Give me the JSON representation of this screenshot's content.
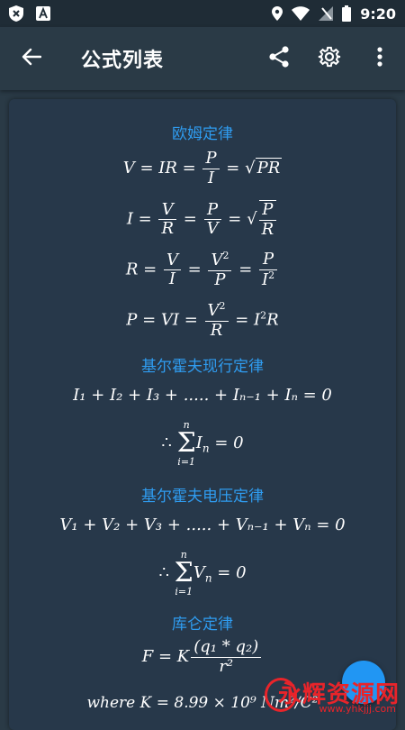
{
  "status_bar": {
    "time": "9:20"
  },
  "app_bar": {
    "title": "公式列表"
  },
  "sections": [
    {
      "title": "欧姆定律"
    },
    {
      "title": "基尔霍夫现行定律"
    },
    {
      "title": "基尔霍夫电压定律"
    },
    {
      "title": "库仑定律"
    }
  ],
  "formulas": {
    "ohm1": {
      "lhs": "V = IR = ",
      "p": "P",
      "i": "I",
      "eq": " = √",
      "pr": "PR"
    },
    "ohm2": {
      "lhs": "I = ",
      "v": "V",
      "r": "R",
      "eq": " = ",
      "p": "P",
      "v2": "V",
      "eq2": " = √",
      "p2": "P",
      "r2": "R"
    },
    "ohm3": {
      "lhs": "R = ",
      "v": "V",
      "i": "I",
      "eq": " = ",
      "v2": "V",
      "sq": "2",
      "p": "P",
      "eq2": " = ",
      "p2": "P",
      "i2": "I",
      "sq2": "2"
    },
    "ohm4": {
      "lhs": "P = VI = ",
      "v": "V",
      "sq": "2",
      "r": "R",
      "eq": " = I",
      "sq2": "2",
      "rhs": "R"
    },
    "kcl1": "I₁ + I₂ + I₃ + ..... + Iₙ₋₁ + Iₙ = 0",
    "kcl2": {
      "therefore": "∴",
      "top": "n",
      "bottom": "i=1",
      "term": "I",
      "sub": "n",
      "rhs": " = 0"
    },
    "kvl1": "V₁ + V₂ + V₃ + ..... + Vₙ₋₁ + Vₙ = 0",
    "kvl2": {
      "therefore": "∴",
      "top": "n",
      "bottom": "i=1",
      "term": "V",
      "sub": "n",
      "rhs": " = 0"
    },
    "coulomb1": {
      "lhs": "F = K",
      "num": "(q₁ * q₂)",
      "den": "r²"
    },
    "coulomb2": "where K = 8.99 × 10⁹ Nm²/C²"
  },
  "watermark": {
    "main": "永辉资源网",
    "sub": "www.yhkjjj.com"
  },
  "colors": {
    "background": "#2a3a46",
    "card": "#27384a",
    "accent": "#2f9cf0",
    "fab": "#2196f3"
  }
}
